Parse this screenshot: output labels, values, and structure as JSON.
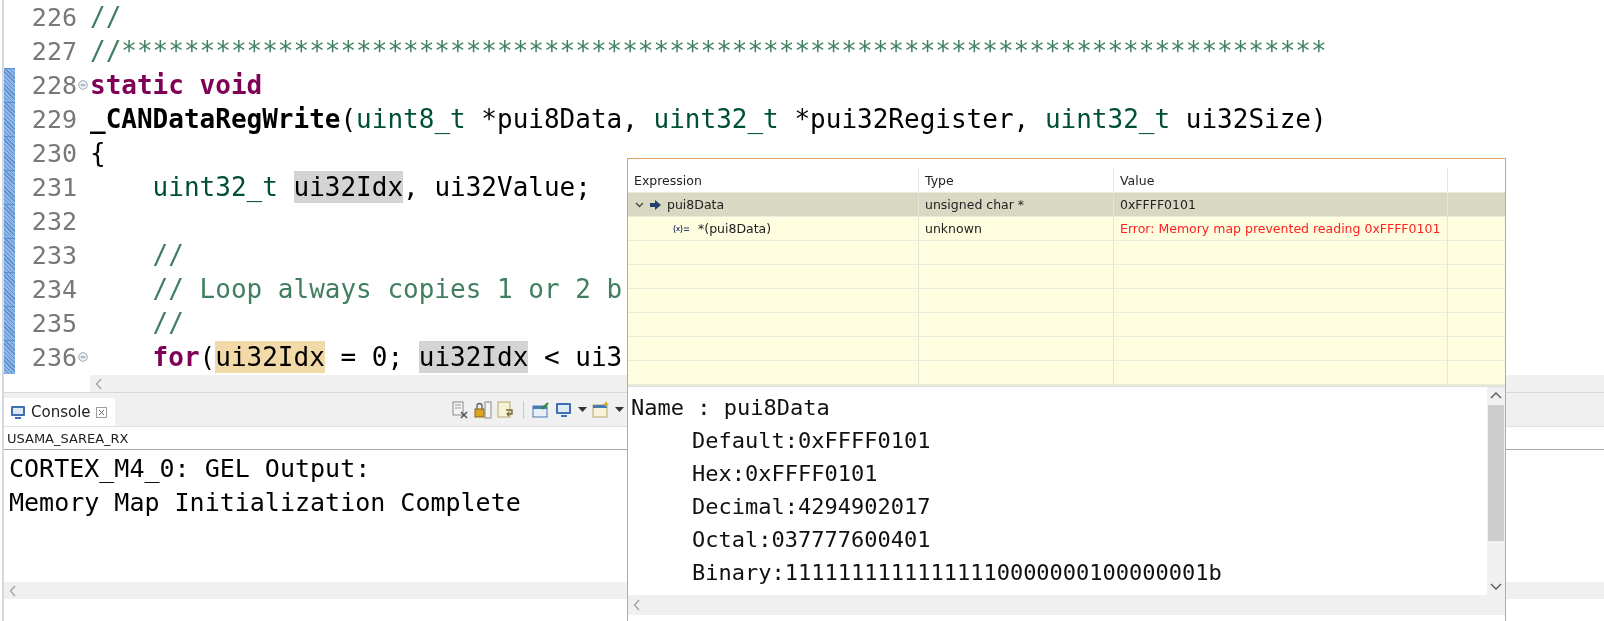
{
  "editor": {
    "lines": [
      {
        "number": "226",
        "fold": false,
        "changed": false,
        "tokens": [
          {
            "kind": "comment",
            "text": "//"
          }
        ]
      },
      {
        "number": "227",
        "fold": false,
        "changed": false,
        "tokens": [
          {
            "kind": "comment",
            "text": "//*****************************************************************************"
          }
        ]
      },
      {
        "number": "228",
        "fold": true,
        "changed": true,
        "tokens": [
          {
            "kind": "keyword",
            "text": "static void"
          }
        ]
      },
      {
        "number": "229",
        "fold": false,
        "changed": true,
        "tokens": [
          {
            "kind": "function",
            "text": "_CANDataRegWrite"
          },
          {
            "kind": "plain",
            "text": "("
          },
          {
            "kind": "type",
            "text": "uint8_t"
          },
          {
            "kind": "plain",
            "text": " *pui8Data, "
          },
          {
            "kind": "type",
            "text": "uint32_t"
          },
          {
            "kind": "plain",
            "text": " *pui32Register, "
          },
          {
            "kind": "type",
            "text": "uint32_t"
          },
          {
            "kind": "plain",
            "text": " ui32Size)"
          }
        ]
      },
      {
        "number": "230",
        "fold": false,
        "changed": true,
        "tokens": [
          {
            "kind": "plain",
            "text": "{"
          }
        ]
      },
      {
        "number": "231",
        "fold": false,
        "changed": true,
        "tokens": [
          {
            "kind": "type",
            "text": "    uint32_t "
          },
          {
            "kind": "plain",
            "text": "ui32Idx",
            "highlighted": true,
            "written": false
          },
          {
            "kind": "plain",
            "text": ", ui32Value;"
          }
        ]
      },
      {
        "number": "232",
        "fold": false,
        "changed": true
      },
      {
        "number": "233",
        "fold": false,
        "changed": true,
        "tokens": [
          {
            "kind": "comment",
            "text": "    //"
          }
        ]
      },
      {
        "number": "234",
        "fold": false,
        "changed": true,
        "tokens": [
          {
            "kind": "comment",
            "text": "    // Loop always copies 1 or 2 b"
          }
        ]
      },
      {
        "number": "235",
        "fold": false,
        "changed": true,
        "tokens": [
          {
            "kind": "comment",
            "text": "    //"
          }
        ]
      },
      {
        "number": "236",
        "fold": true,
        "changed": true,
        "tokens": [
          {
            "kind": "keyword",
            "text": "    for"
          },
          {
            "kind": "plain",
            "text": "("
          },
          {
            "kind": "plain",
            "text": "ui32Idx",
            "highlighted": true,
            "written": true
          },
          {
            "kind": "plain",
            "text": " = 0; "
          },
          {
            "kind": "plain",
            "text": "ui32Idx",
            "highlighted": true,
            "written": false
          },
          {
            "kind": "plain",
            "text": " < ui3"
          }
        ]
      }
    ]
  },
  "console": {
    "tab": {
      "label": "Console",
      "selected": true
    },
    "process": "USAMA_SAREA_RX",
    "output": [
      "CORTEX_M4_0: GEL Output:",
      "Memory Map Initialization Complete"
    ]
  },
  "hover": {
    "columns": [
      "Expression",
      "Type",
      "Value"
    ],
    "rows": [
      {
        "kind": "pointer",
        "expanded": true,
        "selected": true,
        "error": false,
        "expression": "pui8Data",
        "type": "unsigned char *",
        "value": "0xFFFF0101"
      },
      {
        "kind": "child",
        "selected": false,
        "error": true,
        "expression": "*(pui8Data)",
        "type": "unknown",
        "value": "Error: Memory map prevented reading 0xFFFF0101"
      }
    ],
    "details": {
      "name_line": "Name : pui8Data",
      "formats": [
        "Default:0xFFFF0101",
        "Hex:0xFFFF0101",
        "Decimal:4294902017",
        "Octal:037777600401",
        "Binary:11111111111111110000000100000001b"
      ]
    }
  }
}
